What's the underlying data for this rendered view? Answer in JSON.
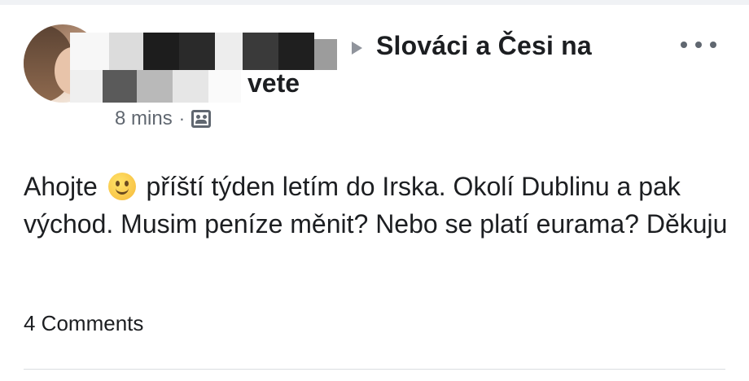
{
  "post": {
    "group_name_line1": "Slováci a Česi na",
    "group_name_line2": "světe",
    "group_name_line2_visible": "vete",
    "timestamp": "8 mins",
    "separator": "·",
    "audience_icon": "group-icon",
    "text_before_emoji": "Ahojte ",
    "emoji": "slightly-smiling-face",
    "text_after_emoji": " příští týden letím do Irska. Okolí Dublinu a pak východ. Musim peníze měnit? Nebo se platí eurama? Děkuju",
    "comments": "4 Comments",
    "more_icon": "more-options-icon"
  },
  "colors": {
    "text": "#1c1e21",
    "secondary_text": "#606770",
    "arrow": "#90949c",
    "divider": "#dadde1"
  }
}
